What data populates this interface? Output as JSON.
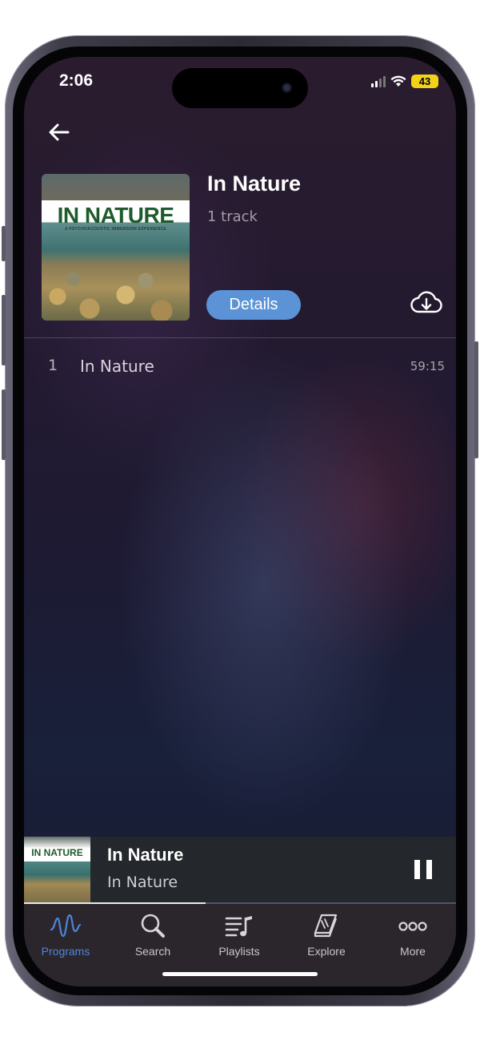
{
  "status_bar": {
    "time": "2:06",
    "battery_level": "43"
  },
  "header": {
    "back_icon": "arrow-left-icon"
  },
  "album": {
    "cover_title": "IN NATURE",
    "cover_subtitle": "A PSYCHOACOUSTIC IMMERSION EXPERIENCE",
    "title": "In Nature",
    "track_count": "1 track",
    "details_label": "Details",
    "download_icon": "cloud-download-icon"
  },
  "tracks": [
    {
      "number": "1",
      "title": "In Nature",
      "duration": "59:15"
    }
  ],
  "mini_player": {
    "art_title": "IN NATURE",
    "title": "In Nature",
    "subtitle": "In Nature",
    "progress": 0.42
  },
  "tabbar": {
    "items": [
      {
        "label": "Programs",
        "icon": "waveform-icon",
        "active": true
      },
      {
        "label": "Search",
        "icon": "magnifier-icon",
        "active": false
      },
      {
        "label": "Playlists",
        "icon": "playlist-icon",
        "active": false
      },
      {
        "label": "Explore",
        "icon": "book-icon",
        "active": false
      },
      {
        "label": "More",
        "icon": "more-dots-icon",
        "active": false
      }
    ]
  },
  "colors": {
    "accent": "#5b93d6",
    "tab_active": "#4f86d9",
    "battery": "#f3d218",
    "mini_player_bg": "#24272b",
    "tabbar_bg": "#2a262c"
  }
}
